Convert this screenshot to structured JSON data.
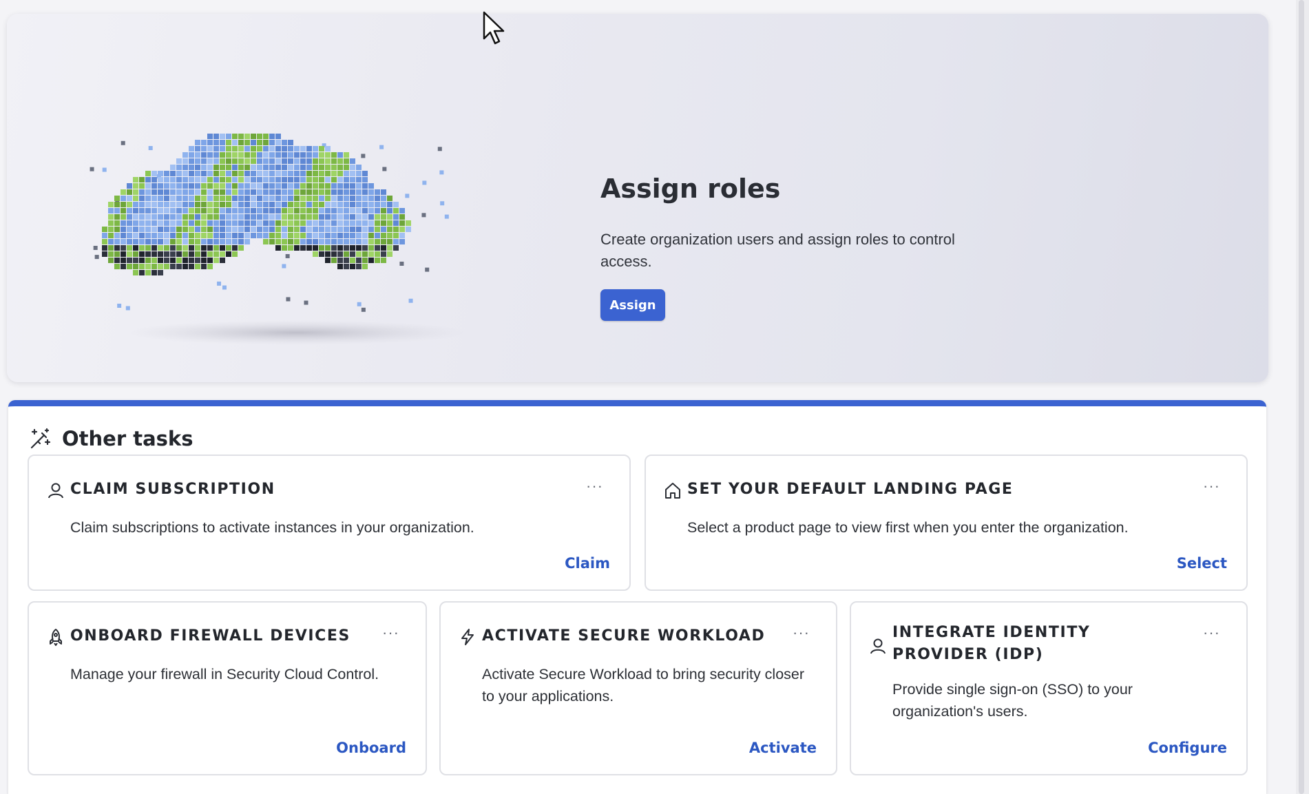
{
  "hero": {
    "title": "Assign roles",
    "description": "Create organization users and assign roles to control access.",
    "button_label": "Assign"
  },
  "tasks": {
    "title": "Other tasks",
    "cards": [
      {
        "title": "CLAIM SUBSCRIPTION",
        "icon": "user-icon",
        "more": "···",
        "description": "Claim subscriptions to activate instances in your organization.",
        "action": "Claim"
      },
      {
        "title": "SET YOUR DEFAULT LANDING PAGE",
        "icon": "home-icon",
        "more": "···",
        "description": "Select a product page to view first when you enter the organization.",
        "action": "Select"
      },
      {
        "title": "ONBOARD FIREWALL DEVICES",
        "icon": "rocket-icon",
        "more": "···",
        "description": "Manage your firewall in Security Cloud Control.",
        "action": "Onboard"
      },
      {
        "title": "ACTIVATE SECURE WORKLOAD",
        "icon": "lightning-icon",
        "more": "···",
        "description": "Activate Secure Workload to bring security closer to your applications.",
        "action": "Activate"
      },
      {
        "title": "INTEGRATE IDENTITY PROVIDER (IDP)",
        "icon": "user-icon",
        "more": "···",
        "description": "Provide single sign-on (SSO) to your organization's users.",
        "action": "Configure"
      }
    ]
  },
  "colors": {
    "accent": "#3b63d1",
    "link": "#2b57c2"
  }
}
